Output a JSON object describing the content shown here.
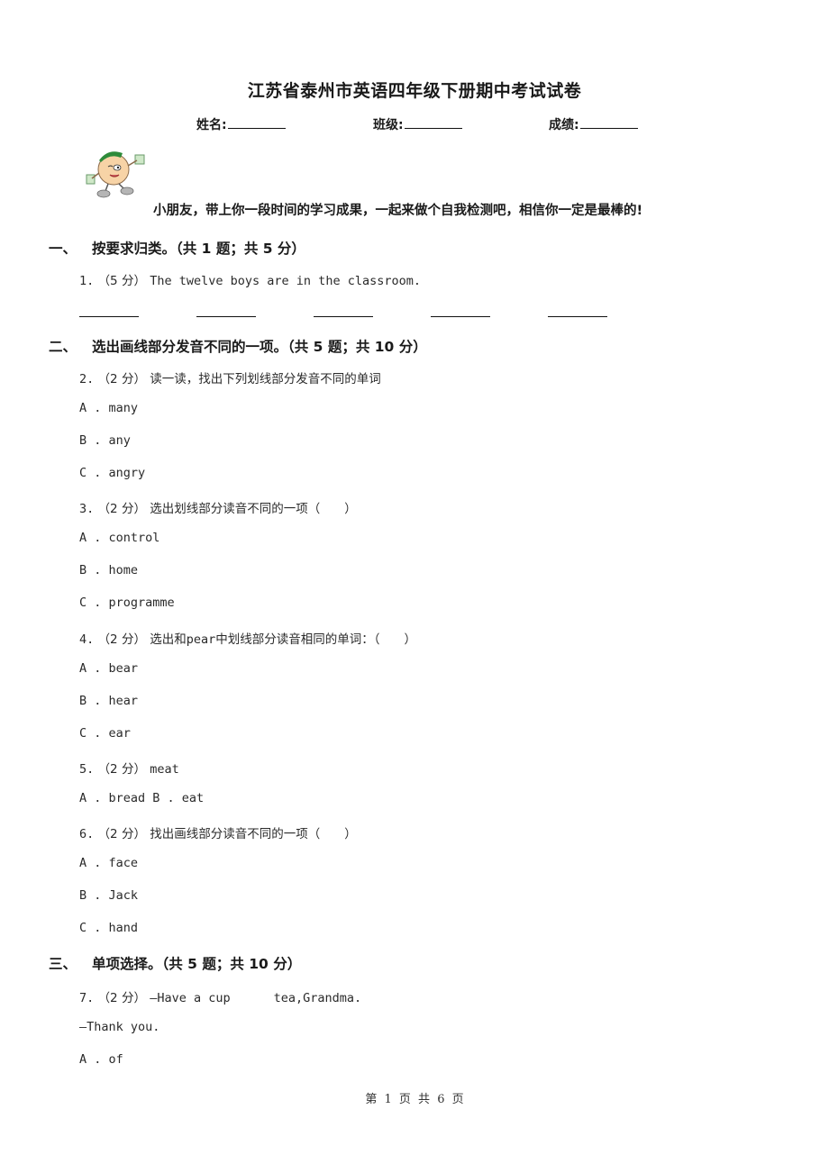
{
  "document": {
    "title": "江苏省泰州市英语四年级下册期中考试试卷",
    "info_fields": [
      {
        "label": "姓名:"
      },
      {
        "label": "班级:"
      },
      {
        "label": "成绩:"
      }
    ],
    "mascot": "cartoon-mascot",
    "encouragement": "小朋友，带上你一段时间的学习成果，一起来做个自我检测吧，相信你一定是最棒的!",
    "footer": "第 1 页 共 6 页"
  },
  "sections": [
    {
      "number": "一、",
      "title": "按要求归类。（共 1 题；共 5 分）",
      "questions": [
        {
          "number": "1.",
          "points": "（5 分）",
          "text": "The twelve boys are in the classroom.",
          "answer_blanks": 5
        }
      ]
    },
    {
      "number": "二、",
      "title": "选出画线部分发音不同的一项。（共 5 题；共 10 分）",
      "questions": [
        {
          "number": "2.",
          "points": "（2 分）",
          "text": "读一读，找出下列划线部分发音不同的单词",
          "options": [
            "A . many",
            "B . any",
            "C . angry"
          ]
        },
        {
          "number": "3.",
          "points": "（2 分）",
          "text": "选出划线部分读音不同的一项（　　）",
          "options": [
            "A . control",
            "B . home",
            "C . programme"
          ]
        },
        {
          "number": "4.",
          "points": "（2 分）",
          "text_before": "选出和",
          "text_word": "pear",
          "text_after": "中划线部分读音相同的单词：（　　）",
          "options": [
            "A . bear",
            "B . hear",
            "C . ear"
          ]
        },
        {
          "number": "5.",
          "points": "（2 分）",
          "text": "meat",
          "options_inline": "A . bread B . eat"
        },
        {
          "number": "6.",
          "points": "（2 分）",
          "text": "找出画线部分读音不同的一项（　　）",
          "options": [
            "A . face",
            "B . Jack",
            "C . hand"
          ]
        }
      ]
    },
    {
      "number": "三、",
      "title": "单项选择。（共 5 题；共 10 分）",
      "questions": [
        {
          "number": "7.",
          "points": "（2 分）",
          "text_before": "—Have a cup",
          "text_after": "tea,Grandma.",
          "reply": "—Thank you.",
          "options": [
            "A . of"
          ]
        }
      ]
    }
  ]
}
